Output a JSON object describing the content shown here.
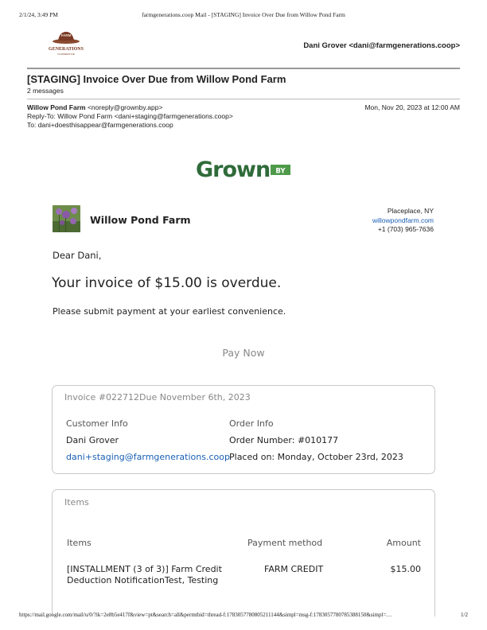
{
  "print_header": {
    "datetime": "2/1/24, 3:49 PM",
    "title": "farmgenerations.coop Mail - [STAGING] Invoice Over Due from Willow Pond Farm"
  },
  "account": {
    "name_email": "Dani Grover <dani@farmgenerations.coop>",
    "logo_icon": "farm-generations-logo",
    "logo_text_top": "FARM",
    "logo_text_main": "GENERATIONS",
    "logo_text_sub": "COOPERATIVE"
  },
  "thread": {
    "subject": "[STAGING] Invoice Over Due from Willow Pond Farm",
    "message_count": "2 messages"
  },
  "message": {
    "from_name": "Willow Pond Farm",
    "from_email": "<noreply@grownby.app>",
    "reply_to": "Reply-To: Willow Pond Farm <dani+staging@farmgenerations.coop>",
    "to": "To: dani+doesthisappear@farmgenerations.coop",
    "date": "Mon, Nov 20, 2023 at 12:00 AM"
  },
  "email": {
    "brand": {
      "logo_word": "Grown",
      "logo_badge": "BY",
      "color_green": "#2f6b3a",
      "color_badge": "#4e9a4a"
    },
    "farm": {
      "name": "Willow Pond Farm",
      "location": "Placeplace, NY",
      "website": "willowpondfarm.com",
      "phone": "+1 (703) 965-7636"
    },
    "greeting": "Dear Dani,",
    "headline": "Your invoice of $15.00 is overdue.",
    "body": "Please submit payment at your earliest convenience.",
    "pay_button": "Pay Now",
    "invoice": {
      "title": "Invoice #022712Due November 6th, 2023",
      "customer_label": "Customer Info",
      "customer_name": "Dani Grover",
      "customer_email": "dani+staging@farmgenerations.coop",
      "order_label": "Order Info",
      "order_number": "Order Number: #010177",
      "placed_on": "Placed on: Monday, October 23rd, 2023"
    },
    "items": {
      "title": "Items",
      "columns": [
        "Items",
        "Payment method",
        "Amount"
      ],
      "rows": [
        {
          "description": "[INSTALLMENT (3 of 3)] Farm Credit Deduction NotificationTest, Testing",
          "payment_method": "FARM CREDIT",
          "amount": "$15.00"
        }
      ]
    }
  },
  "print_footer": {
    "url": "https://mail.google.com/mail/u/0/?ik=2e8b5e417f&view=pt&search=all&permthid=thread-f:1783057780805211144&simpl=msg-f:1783057780785388150&simpl=…",
    "page": "1/2"
  }
}
